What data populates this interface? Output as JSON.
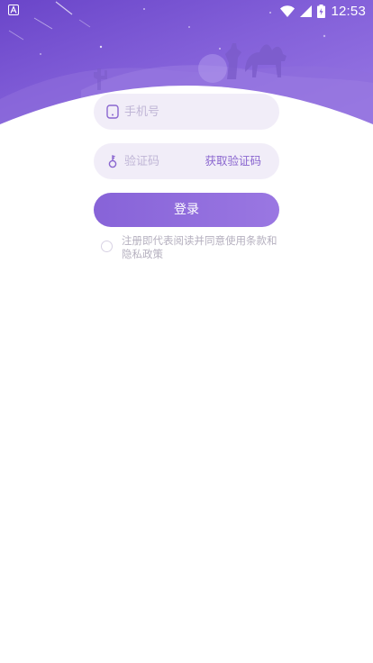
{
  "status_bar": {
    "time": "12:53",
    "left_icon": "a-notification-icon",
    "icons": [
      "wifi-icon",
      "signal-icon",
      "battery-icon"
    ]
  },
  "banner": {
    "illustration": "desert-night-travelers"
  },
  "form": {
    "phone": {
      "placeholder": "手机号",
      "value": "",
      "icon": "phone-icon"
    },
    "code": {
      "placeholder": "验证码",
      "value": "",
      "icon": "key-icon",
      "get_code_label": "获取验证码"
    },
    "login_label": "登录",
    "agreement": {
      "checked": false,
      "text": "注册即代表阅读并同意使用条款和隐私政策"
    }
  },
  "colors": {
    "accent": "#8a66cf",
    "banner": "#7b55d3",
    "field_bg": "#f1edf8",
    "muted_text": "#b5b0bf"
  }
}
